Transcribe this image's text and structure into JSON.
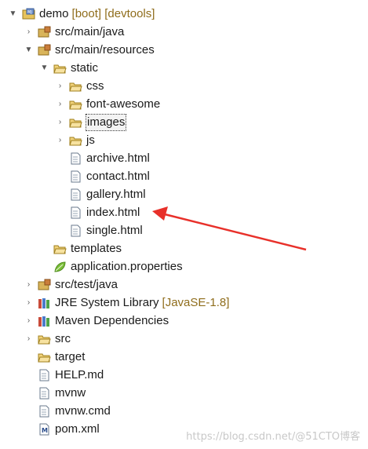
{
  "tree": {
    "project": {
      "name": "demo",
      "decoration": "[boot] [devtools]"
    },
    "src_main_java": "src/main/java",
    "src_main_resources": "src/main/resources",
    "static": "static",
    "css": "css",
    "font_awesome": "font-awesome",
    "images": "images",
    "js": "js",
    "archive": "archive.html",
    "contact": "contact.html",
    "gallery": "gallery.html",
    "index": "index.html",
    "single": "single.html",
    "templates": "templates",
    "application_properties": "application.properties",
    "src_test_java": "src/test/java",
    "jre": {
      "name": "JRE System Library",
      "decoration": "[JavaSE-1.8]"
    },
    "maven_deps": "Maven Dependencies",
    "src": "src",
    "target": "target",
    "help": "HELP.md",
    "mvnw": "mvnw",
    "mvnw_cmd": "mvnw.cmd",
    "pom": "pom.xml"
  },
  "watermark": "https://blog.csdn.net/@51CTO博客",
  "colors": {
    "annotation_arrow": "#e8302a",
    "decoration": "#8f6d1c"
  }
}
